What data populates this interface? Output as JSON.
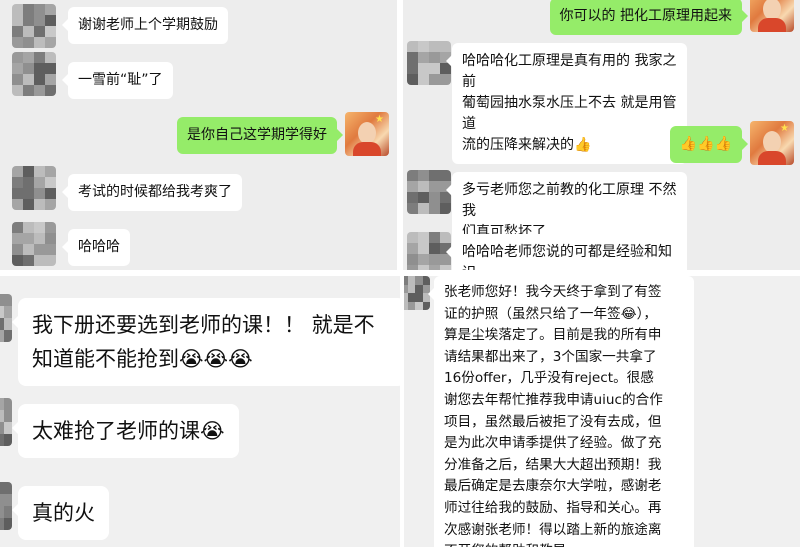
{
  "panels": {
    "top_left": {
      "messages": [
        {
          "from": "other",
          "text": "谢谢老师上个学期鼓励"
        },
        {
          "from": "other",
          "text": "一雪前“耻”了"
        },
        {
          "from": "self",
          "text": "是你自己这学期学得好"
        },
        {
          "from": "other",
          "text": "考试的时候都给我考爽了"
        },
        {
          "from": "other",
          "text": "哈哈哈"
        }
      ]
    },
    "top_right": {
      "messages": [
        {
          "from": "self",
          "text": "你可以的 把化工原理用起来"
        },
        {
          "from": "other",
          "text": "哈哈哈化工原理是真有用的 我家之前\n葡萄园抽水泵水压上不去 就是用管道\n流的压降来解决的👍"
        },
        {
          "from": "self",
          "text": "👍👍👍"
        },
        {
          "from": "other",
          "text": "多亏老师您之前教的化工原理 不然我\n们真可愁坏了"
        },
        {
          "from": "other",
          "text": "哈哈哈老师您说的可都是经验和知识\n啊 学不够的"
        }
      ]
    },
    "bottom_left": {
      "messages": [
        {
          "from": "other",
          "text": "我下册还要选到老师的课！！ 就是不\n知道能不能抢到😭😭😭"
        },
        {
          "from": "other",
          "text": "太难抢了老师的课😭"
        },
        {
          "from": "other",
          "text": "真的火"
        }
      ]
    },
    "bottom_right": {
      "messages": [
        {
          "from": "other",
          "text": "张老师您好！我今天终于拿到了有签\n证的护照（虽然只给了一年签😂），\n算是尘埃落定了。目前是我的所有申\n请结果都出来了，3个国家一共拿了\n16份offer，几乎没有reject。很感\n谢您去年帮忙推荐我申请uiuc的合作\n项目，虽然最后被拒了没有去成，但\n是为此次申请季提供了经验。做了充\n分准备之后，结果大大超出预期！我\n最后确定是去康奈尔大学啦，感谢老\n师过往给我的鼓励、指导和关心。再\n次感谢张老师！得以踏上新的旅途离\n不开您的帮助和教导。"
        }
      ]
    }
  },
  "colors": {
    "outgoing": "#95ec69",
    "incoming": "#ffffff",
    "chat_bg": "#ededed"
  },
  "icons": {
    "self_avatar": "avatar-photo",
    "other_avatar": "blurred-avatar"
  }
}
